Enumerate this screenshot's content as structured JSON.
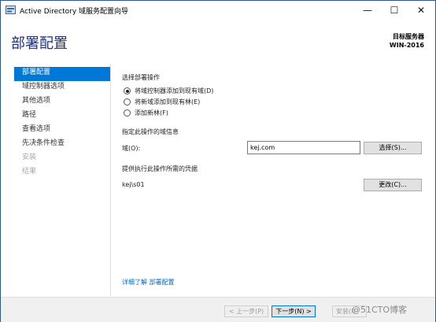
{
  "window": {
    "title": "Active Directory 域服务配置向导",
    "minimize_glyph": "—",
    "maximize_glyph": "☐",
    "close_glyph": "✕"
  },
  "header": {
    "title": "部署配置",
    "target_label": "目标服务器",
    "target_server": "WIN-2016"
  },
  "nav": {
    "items": [
      {
        "label": "部署配置",
        "state": "active"
      },
      {
        "label": "域控制器选项",
        "state": "normal"
      },
      {
        "label": "其他选项",
        "state": "normal"
      },
      {
        "label": "路径",
        "state": "normal"
      },
      {
        "label": "查看选项",
        "state": "normal"
      },
      {
        "label": "先决条件检查",
        "state": "normal"
      },
      {
        "label": "安装",
        "state": "disabled"
      },
      {
        "label": "结果",
        "state": "disabled"
      }
    ]
  },
  "main": {
    "operation_heading": "选择部署操作",
    "options": [
      {
        "label": "将域控制器添加到现有域(D)",
        "checked": true
      },
      {
        "label": "将新域添加到现有林(E)",
        "checked": false
      },
      {
        "label": "添加新林(F)",
        "checked": false
      }
    ],
    "domain_info_heading": "指定此操作的域信息",
    "domain_label": "域(O):",
    "domain_value": "kej.com",
    "select_button": "选择(S)...",
    "credentials_heading": "提供执行此操作所需的凭据",
    "credentials_value": "kej\\s01",
    "change_button": "更改(C)...",
    "learn_more_link": "详细了解 部署配置"
  },
  "footer": {
    "prev_button": "< 上一步(P)",
    "next_button": "下一步(N) >",
    "install_button": "安装(I)",
    "watermark": "@51CTO博客"
  },
  "colors": {
    "accent": "#0078d7",
    "heading": "#1e3287",
    "link": "#0066cc"
  }
}
